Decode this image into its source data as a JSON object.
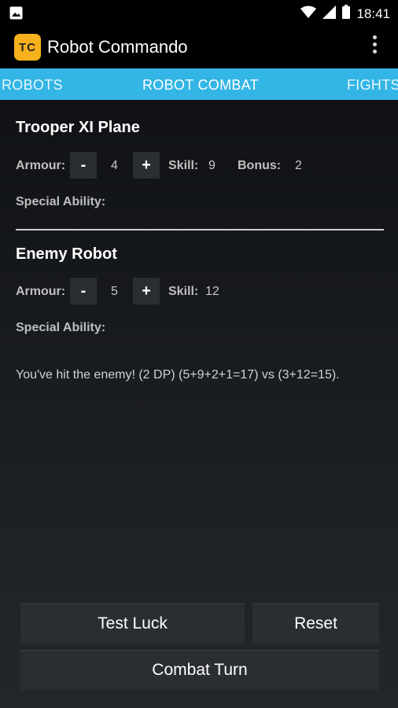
{
  "status_bar": {
    "time": "18:41",
    "icons": [
      "image-icon",
      "wifi-icon",
      "signal-icon",
      "battery-icon"
    ]
  },
  "app_bar": {
    "logo_text": "TC",
    "title": "Robot Commando",
    "menu_icon": "overflow-menu-icon"
  },
  "tabs": {
    "robots": "ROBOTS",
    "combat": "ROBOT COMBAT",
    "fights": "FIGHTS"
  },
  "player": {
    "name": "Trooper XI Plane",
    "armour_label": "Armour:",
    "armour_value": "4",
    "skill_label": "Skill:",
    "skill_value": "9",
    "bonus_label": "Bonus:",
    "bonus_value": "2",
    "special_label": "Special Ability:"
  },
  "enemy": {
    "name": "Enemy Robot",
    "armour_label": "Armour:",
    "armour_value": "5",
    "skill_label": "Skill:",
    "skill_value": "12",
    "special_label": "Special Ability:"
  },
  "stepper": {
    "minus": "-",
    "plus": "+"
  },
  "message": "You've hit the enemy! (2 DP) (5+9+2+1=17) vs (3+12=15).",
  "buttons": {
    "test_luck": "Test Luck",
    "reset": "Reset",
    "combat_turn": "Combat Turn"
  },
  "colors": {
    "tab_bar": "#33b5e5",
    "logo": "#f6b11d"
  }
}
